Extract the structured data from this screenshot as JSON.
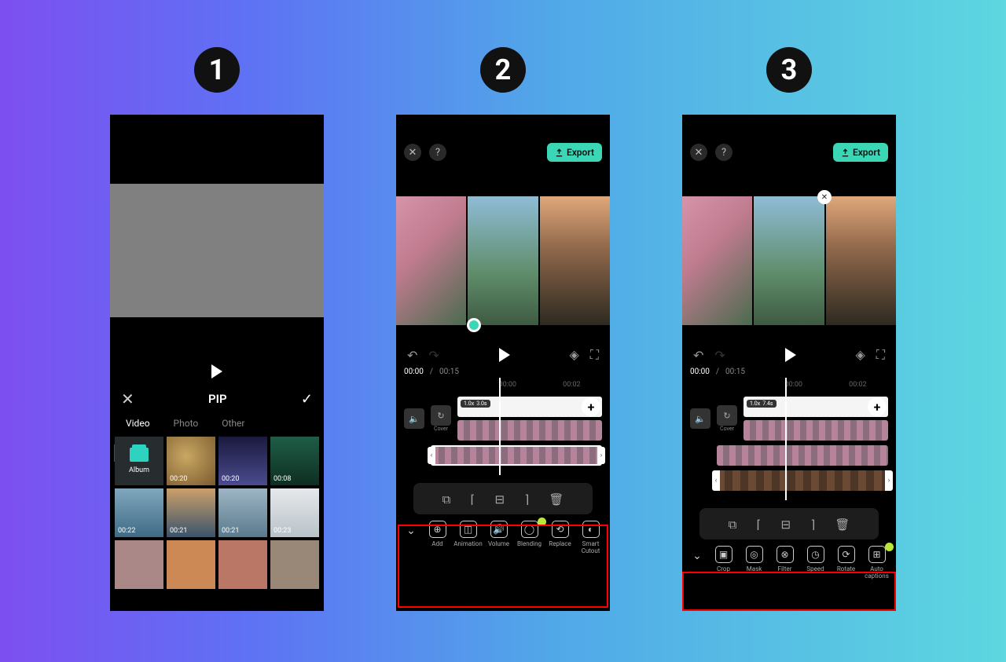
{
  "steps": [
    "1",
    "2",
    "3"
  ],
  "s1": {
    "title": "PIP",
    "tabs": [
      "Video",
      "Photo",
      "Other"
    ],
    "album_label": "Album",
    "thumbs": [
      "00:20",
      "00:20",
      "00:08",
      "00:22",
      "00:21",
      "00:21",
      "00:23"
    ]
  },
  "editor": {
    "export": "Export",
    "time_current": "00:00",
    "time_total": "00:15",
    "ruler": [
      "00:00",
      "00:02"
    ],
    "cover": "Cover",
    "speed2": [
      "1.0x",
      "3.0s"
    ],
    "speed3": [
      "1.0x",
      "7.4s"
    ],
    "tools2": [
      "Add",
      "Animation",
      "Volume",
      "Blending",
      "Replace",
      "Smart Cutout"
    ],
    "tools3": [
      "Crop",
      "Mask",
      "Filter",
      "Speed",
      "Rotate",
      "Auto captions"
    ]
  }
}
